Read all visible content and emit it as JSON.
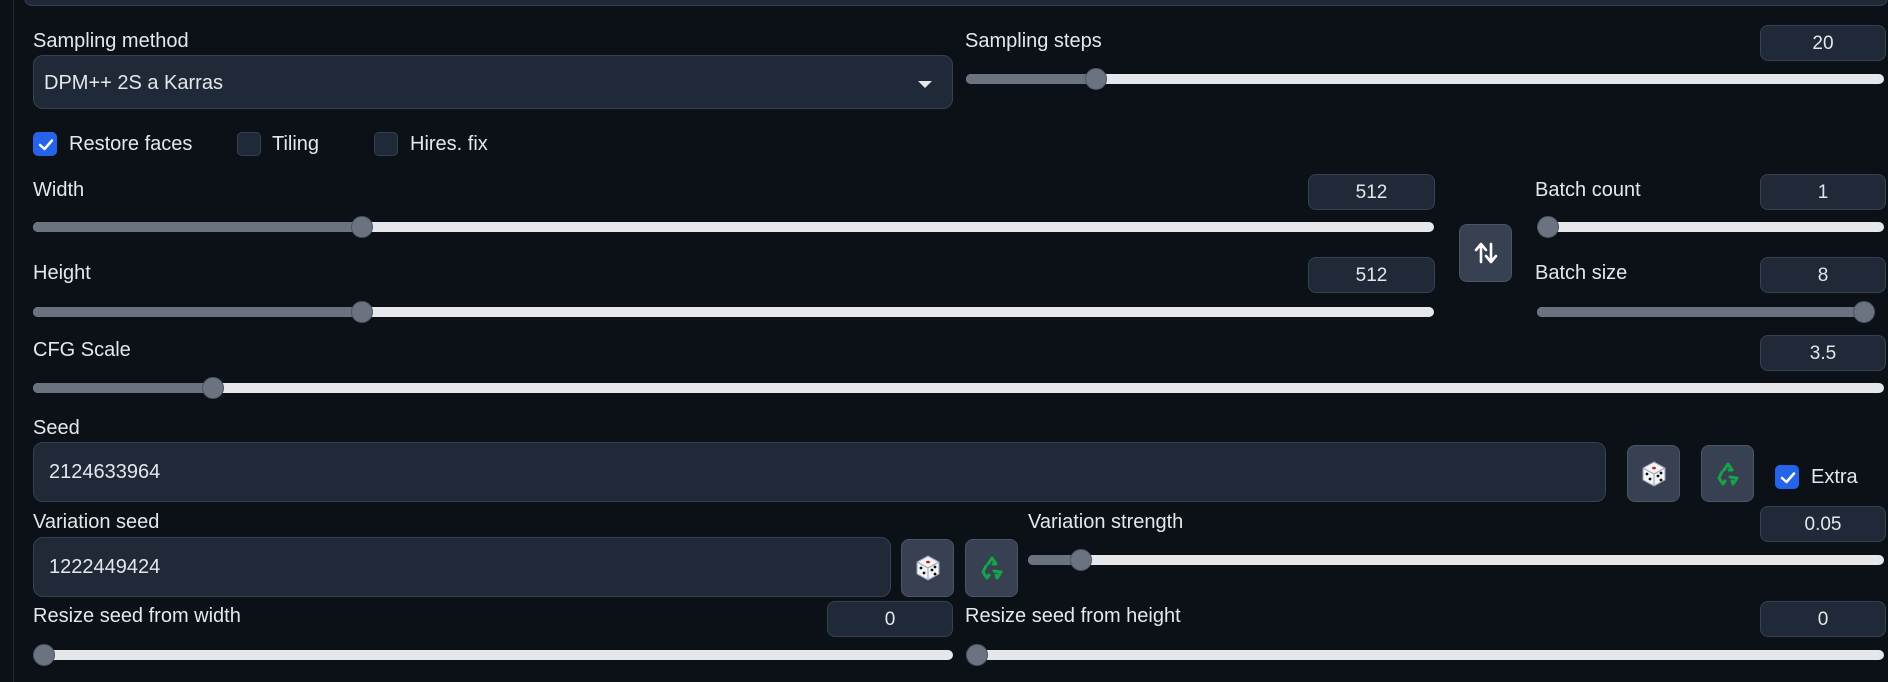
{
  "sampling": {
    "method_label": "Sampling method",
    "method_value": "DPM++ 2S a Karras",
    "steps_label": "Sampling steps",
    "steps_value": "20",
    "steps_fraction": 0.1333
  },
  "checks": {
    "restore_faces": "Restore faces",
    "restore_faces_checked": true,
    "tiling": "Tiling",
    "tiling_checked": false,
    "hires_fix": "Hires. fix",
    "hires_fix_checked": false
  },
  "width": {
    "label": "Width",
    "value": "512",
    "fraction": 0.2304
  },
  "height": {
    "label": "Height",
    "value": "512",
    "fraction": 0.2304
  },
  "swap_icon": "swap-arrows-icon",
  "batch_count": {
    "label": "Batch count",
    "value": "1",
    "fraction": 0.0
  },
  "batch_size": {
    "label": "Batch size",
    "value": "8",
    "fraction": 1.0
  },
  "cfg": {
    "label": "CFG Scale",
    "value": "3.5",
    "fraction": 0.0926
  },
  "seed": {
    "label": "Seed",
    "value": "2124633964",
    "random_icon": "dice-icon",
    "reuse_icon": "recycle-icon",
    "extra_label": "Extra",
    "extra_checked": true
  },
  "variation_seed": {
    "label": "Variation seed",
    "value": "1222449424"
  },
  "variation_strength": {
    "label": "Variation strength",
    "value": "0.05",
    "fraction": 0.05
  },
  "resize_width": {
    "label": "Resize seed from width",
    "value": "0",
    "fraction": 0.0
  },
  "resize_height": {
    "label": "Resize seed from height",
    "value": "0",
    "fraction": 0.0
  },
  "colors": {
    "background": "#0c1117",
    "panel": "#1f2937",
    "accent": "#2563eb",
    "recycle": "#16a34a"
  }
}
